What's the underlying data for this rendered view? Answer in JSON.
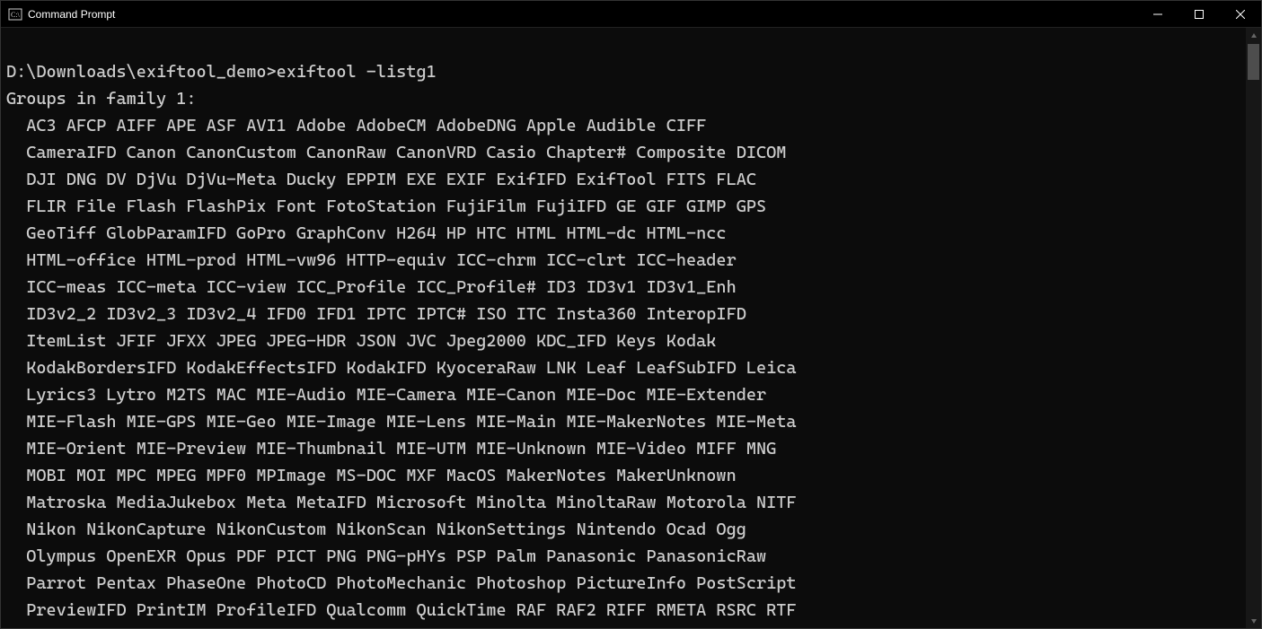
{
  "window": {
    "title": "Command Prompt"
  },
  "terminal": {
    "prompt": "D:\\Downloads\\exiftool_demo>",
    "command": "exiftool -listg1",
    "header": "Groups in family 1:",
    "lines": [
      "  AC3 AFCP AIFF APE ASF AVI1 Adobe AdobeCM AdobeDNG Apple Audible CIFF",
      "  CameraIFD Canon CanonCustom CanonRaw CanonVRD Casio Chapter# Composite DICOM",
      "  DJI DNG DV DjVu DjVu-Meta Ducky EPPIM EXE EXIF ExifIFD ExifTool FITS FLAC",
      "  FLIR File Flash FlashPix Font FotoStation FujiFilm FujiIFD GE GIF GIMP GPS",
      "  GeoTiff GlobParamIFD GoPro GraphConv H264 HP HTC HTML HTML-dc HTML-ncc",
      "  HTML-office HTML-prod HTML-vw96 HTTP-equiv ICC-chrm ICC-clrt ICC-header",
      "  ICC-meas ICC-meta ICC-view ICC_Profile ICC_Profile# ID3 ID3v1 ID3v1_Enh",
      "  ID3v2_2 ID3v2_3 ID3v2_4 IFD0 IFD1 IPTC IPTC# ISO ITC Insta360 InteropIFD",
      "  ItemList JFIF JFXX JPEG JPEG-HDR JSON JVC Jpeg2000 KDC_IFD Keys Kodak",
      "  KodakBordersIFD KodakEffectsIFD KodakIFD KyoceraRaw LNK Leaf LeafSubIFD Leica",
      "  Lyrics3 Lytro M2TS MAC MIE-Audio MIE-Camera MIE-Canon MIE-Doc MIE-Extender",
      "  MIE-Flash MIE-GPS MIE-Geo MIE-Image MIE-Lens MIE-Main MIE-MakerNotes MIE-Meta",
      "  MIE-Orient MIE-Preview MIE-Thumbnail MIE-UTM MIE-Unknown MIE-Video MIFF MNG",
      "  MOBI MOI MPC MPEG MPF0 MPImage MS-DOC MXF MacOS MakerNotes MakerUnknown",
      "  Matroska MediaJukebox Meta MetaIFD Microsoft Minolta MinoltaRaw Motorola NITF",
      "  Nikon NikonCapture NikonCustom NikonScan NikonSettings Nintendo Ocad Ogg",
      "  Olympus OpenEXR Opus PDF PICT PNG PNG-pHYs PSP Palm Panasonic PanasonicRaw",
      "  Parrot Pentax PhaseOne PhotoCD PhotoMechanic Photoshop PictureInfo PostScript",
      "  PreviewIFD PrintIM ProfileIFD Qualcomm QuickTime RAF RAF2 RIFF RMETA RSRC RTF"
    ]
  }
}
